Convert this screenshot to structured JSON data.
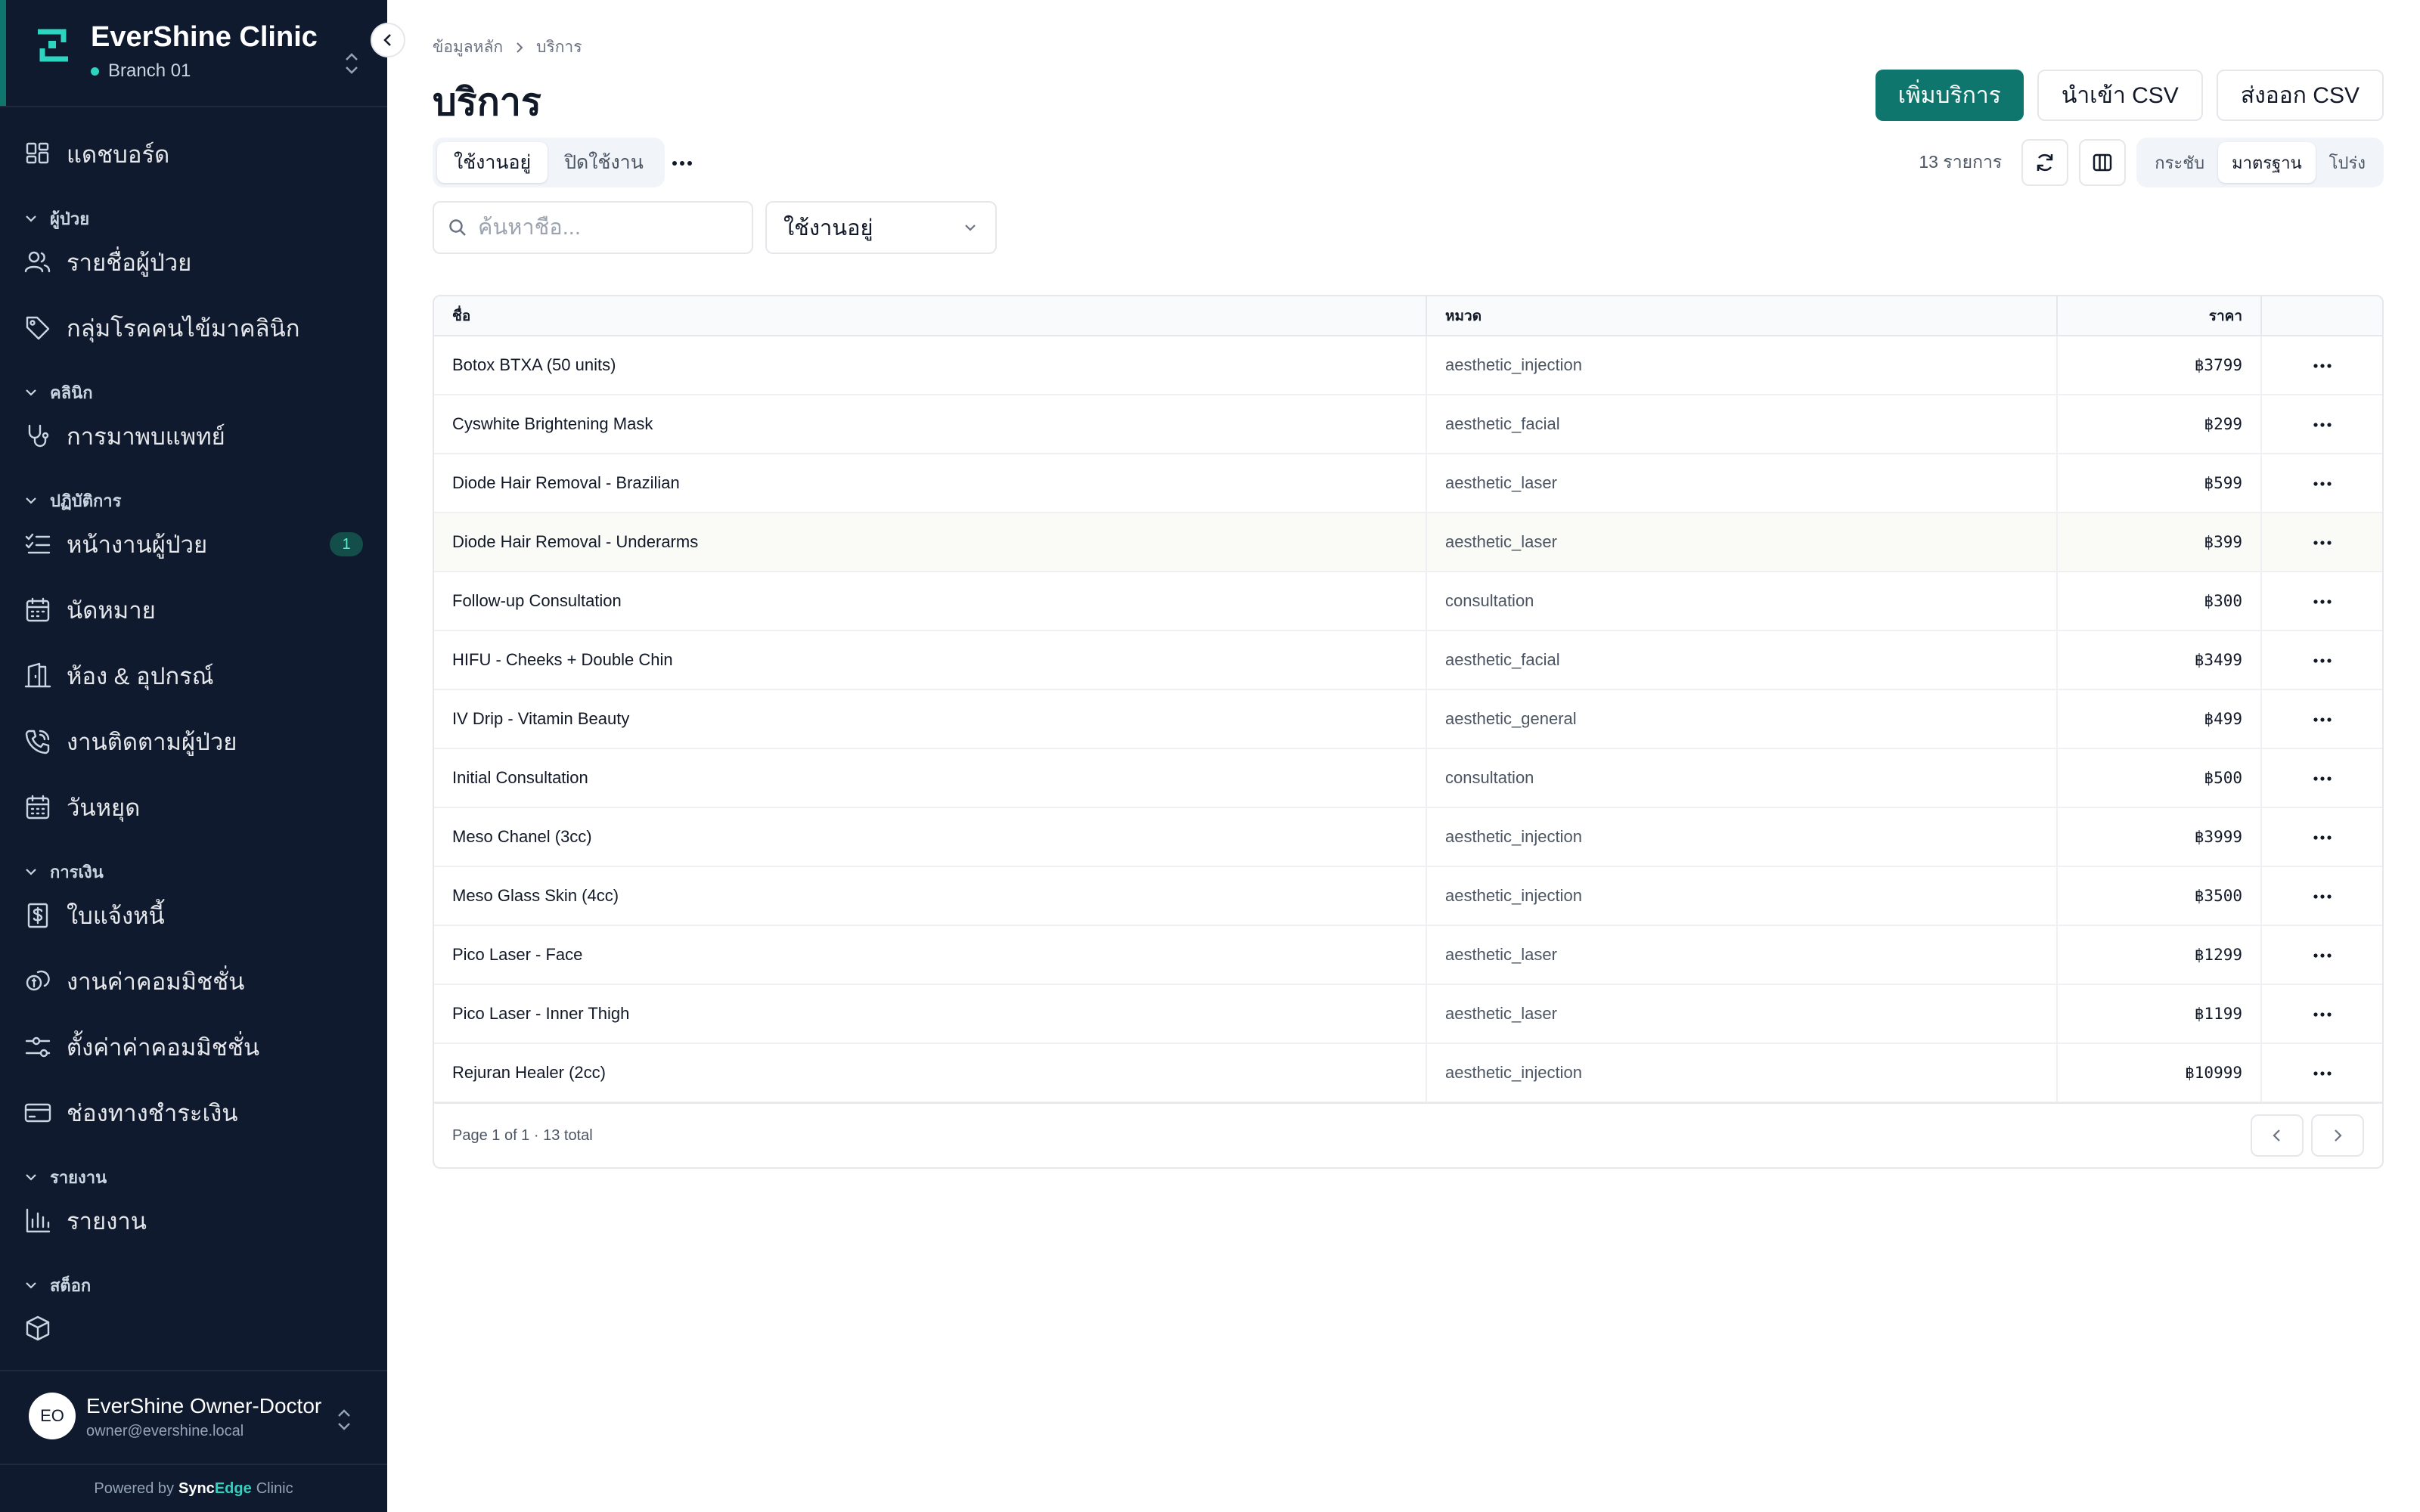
{
  "colors": {
    "sidebar_bg": "#0f1a2e",
    "accent": "#0f766e",
    "badge_text": "#5eead4"
  },
  "sidebar": {
    "clinic_name": "EverShine Clinic",
    "branch": "Branch 01",
    "nav": [
      {
        "type": "item",
        "label": "แดชบอร์ด",
        "icon": "dashboard-icon"
      },
      {
        "type": "section",
        "label": "ผู้ป่วย"
      },
      {
        "type": "item",
        "label": "รายชื่อผู้ป่วย",
        "icon": "users-icon"
      },
      {
        "type": "item",
        "label": "กลุ่มโรคคนไข้มาคลินิก",
        "icon": "tag-icon"
      },
      {
        "type": "section",
        "label": "คลินิก"
      },
      {
        "type": "item",
        "label": "การมาพบแพทย์",
        "icon": "stethoscope-icon"
      },
      {
        "type": "section",
        "label": "ปฏิบัติการ"
      },
      {
        "type": "item",
        "label": "หน้างานผู้ป่วย",
        "icon": "list-check-icon",
        "badge": "1"
      },
      {
        "type": "item",
        "label": "นัดหมาย",
        "icon": "calendar-icon"
      },
      {
        "type": "item",
        "label": "ห้อง & อุปกรณ์",
        "icon": "door-icon"
      },
      {
        "type": "item",
        "label": "งานติดตามผู้ป่วย",
        "icon": "phone-icon"
      },
      {
        "type": "item",
        "label": "วันหยุด",
        "icon": "calendar-holiday-icon"
      },
      {
        "type": "section",
        "label": "การเงิน"
      },
      {
        "type": "item",
        "label": "ใบแจ้งหนี้",
        "icon": "invoice-icon"
      },
      {
        "type": "item",
        "label": "งานค่าคอมมิชชั่น",
        "icon": "coins-icon"
      },
      {
        "type": "item",
        "label": "ตั้งค่าค่าคอมมิชชั่น",
        "icon": "sliders-icon"
      },
      {
        "type": "item",
        "label": "ช่องทางชำระเงิน",
        "icon": "credit-card-icon"
      },
      {
        "type": "section",
        "label": "รายงาน"
      },
      {
        "type": "item",
        "label": "รายงาน",
        "icon": "bar-chart-icon"
      },
      {
        "type": "section",
        "label": "สต็อก"
      },
      {
        "type": "item",
        "label": "",
        "icon": "package-icon"
      }
    ],
    "user": {
      "initials": "EO",
      "name": "EverShine Owner-Doctor",
      "email": "owner@evershine.local"
    },
    "powered": {
      "prefix": "Powered by",
      "brand_a": "Sync",
      "brand_b": "Edge",
      "suffix": "Clinic"
    }
  },
  "breadcrumb": {
    "parent": "ข้อมูลหลัก",
    "current": "บริการ"
  },
  "page_title": "บริการ",
  "actions": {
    "add": "เพิ่มบริการ",
    "import": "นำเข้า CSV",
    "export": "ส่งออก CSV"
  },
  "tabs": {
    "active": "ใช้งานอยู่",
    "inactive": "ปิดใช้งาน"
  },
  "toolbar": {
    "count": "13 รายการ",
    "density": {
      "compact": "กระชับ",
      "standard": "มาตรฐาน",
      "relaxed": "โปร่ง"
    }
  },
  "search": {
    "placeholder": "ค้นหาชื่อ..."
  },
  "filter": {
    "value": "ใช้งานอยู่"
  },
  "table": {
    "columns": {
      "name": "ชื่อ",
      "category": "หมวด",
      "price": "ราคา"
    },
    "rows": [
      {
        "name": "Botox BTXA (50 units)",
        "category": "aesthetic_injection",
        "price": "฿3799"
      },
      {
        "name": "Cyswhite Brightening Mask",
        "category": "aesthetic_facial",
        "price": "฿299"
      },
      {
        "name": "Diode Hair Removal - Brazilian",
        "category": "aesthetic_laser",
        "price": "฿599"
      },
      {
        "name": "Diode Hair Removal - Underarms",
        "category": "aesthetic_laser",
        "price": "฿399"
      },
      {
        "name": "Follow-up Consultation",
        "category": "consultation",
        "price": "฿300"
      },
      {
        "name": "HIFU - Cheeks + Double Chin",
        "category": "aesthetic_facial",
        "price": "฿3499"
      },
      {
        "name": "IV Drip - Vitamin Beauty",
        "category": "aesthetic_general",
        "price": "฿499"
      },
      {
        "name": "Initial Consultation",
        "category": "consultation",
        "price": "฿500"
      },
      {
        "name": "Meso Chanel (3cc)",
        "category": "aesthetic_injection",
        "price": "฿3999"
      },
      {
        "name": "Meso Glass Skin (4cc)",
        "category": "aesthetic_injection",
        "price": "฿3500"
      },
      {
        "name": "Pico Laser - Face",
        "category": "aesthetic_laser",
        "price": "฿1299"
      },
      {
        "name": "Pico Laser - Inner Thigh",
        "category": "aesthetic_laser",
        "price": "฿1199"
      },
      {
        "name": "Rejuran Healer (2cc)",
        "category": "aesthetic_injection",
        "price": "฿10999"
      }
    ],
    "footer": "Page 1 of 1 · 13 total"
  }
}
